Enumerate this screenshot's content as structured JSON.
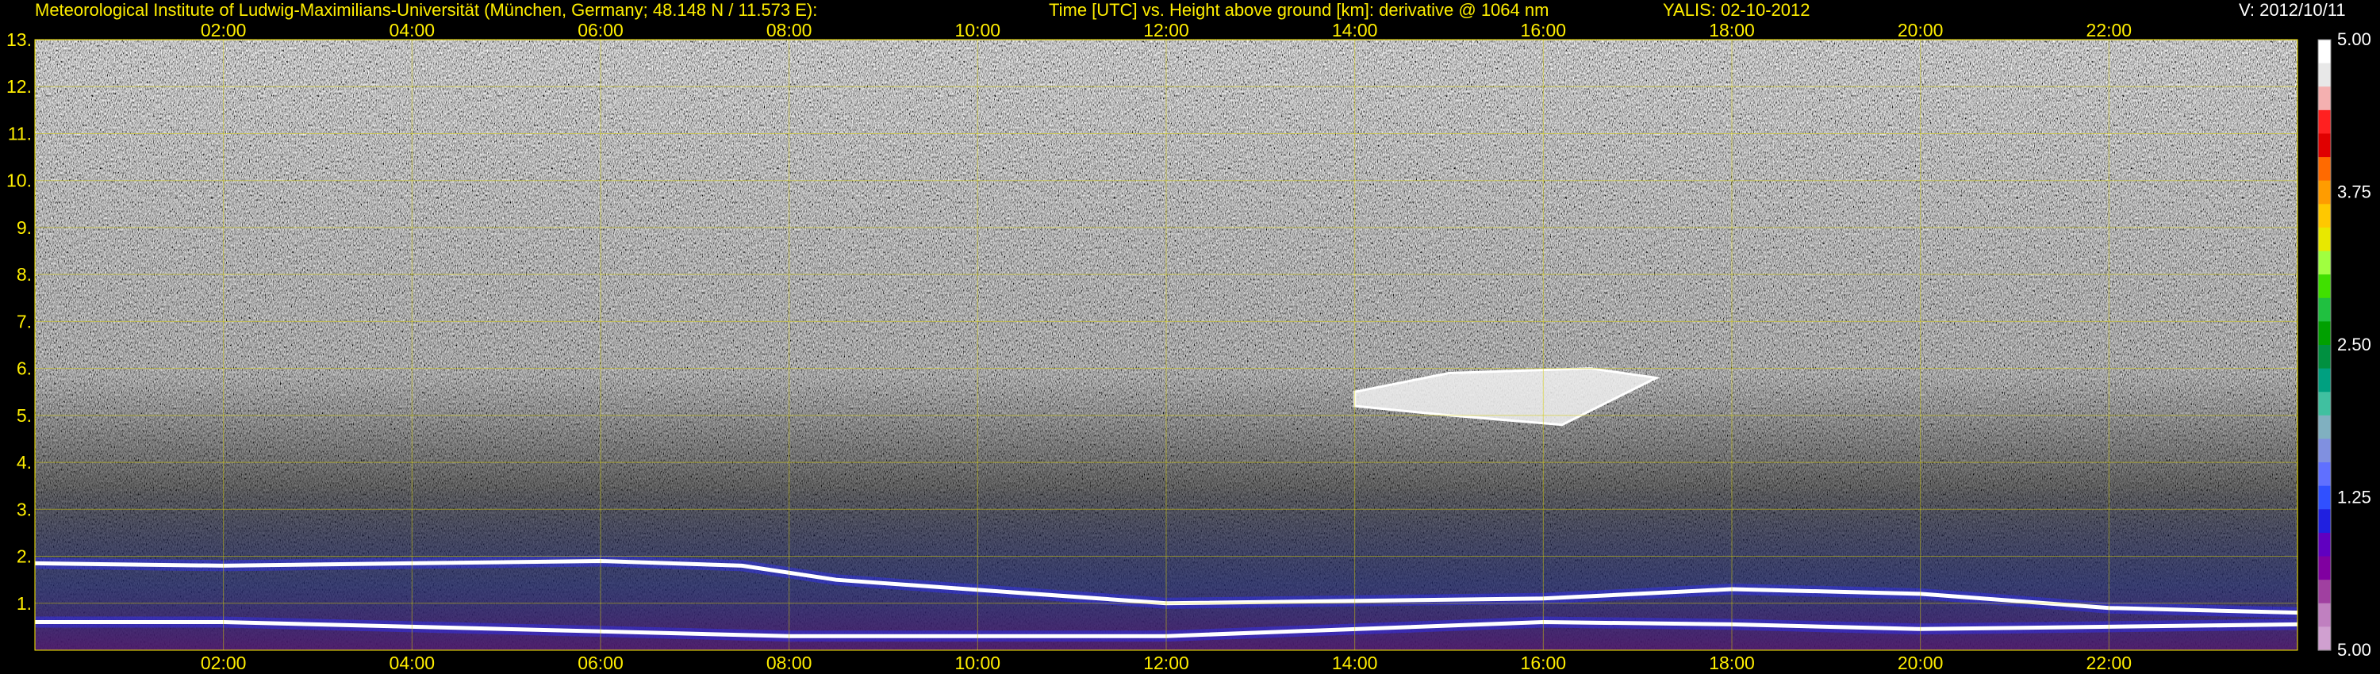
{
  "header": {
    "institution": "Meteorological Institute of Ludwig-Maximilians-Universität (München, Germany; 48.148 N / 11.573 E):",
    "axes_desc": "Time [UTC] vs. Height above ground [km]: derivative @ 1064 nm",
    "device_date": "YALIS: 02-10-2012",
    "version": "V: 2012/10/11"
  },
  "chart_data": {
    "type": "heatmap",
    "title": "Time [UTC] vs. Height above ground [km]: derivative @ 1064 nm",
    "x": {
      "range_hours": [
        0,
        24
      ],
      "ticks": [
        2,
        4,
        6,
        8,
        10,
        12,
        14,
        16,
        18,
        20,
        22
      ],
      "tick_labels": [
        "02:00",
        "04:00",
        "06:00",
        "08:00",
        "10:00",
        "12:00",
        "14:00",
        "16:00",
        "18:00",
        "20:00",
        "22:00"
      ]
    },
    "y": {
      "range_km": [
        0,
        13
      ],
      "ticks": [
        1,
        2,
        3,
        4,
        5,
        6,
        7,
        8,
        9,
        10,
        11,
        12,
        13
      ],
      "tick_labels": [
        "1.",
        "2.",
        "3.",
        "4.",
        "5.",
        "6.",
        "7.",
        "8.",
        "9.",
        "10.",
        "11.",
        "12.",
        "13."
      ]
    },
    "grid": true,
    "colorbar": {
      "tick_labels": [
        "5.00",
        "3.75",
        "2.50",
        "1.25",
        "5.00"
      ],
      "tick_positions": [
        0,
        0.25,
        0.5,
        0.75,
        1.0
      ],
      "colors": [
        "#ffffff",
        "#e8e8e8",
        "#f4b0b0",
        "#ff2020",
        "#e00000",
        "#ff6a00",
        "#ff9c00",
        "#ffc800",
        "#e8e800",
        "#a0ff40",
        "#40e000",
        "#20c040",
        "#00a000",
        "#009040",
        "#00a080",
        "#40c0a0",
        "#80b0c0",
        "#8090e0",
        "#6070ff",
        "#3050ff",
        "#2020e0",
        "#6000c0",
        "#8000a0",
        "#a040a0",
        "#c080c0",
        "#d0a0d0"
      ]
    },
    "features": [
      {
        "name": "aerosol-layer-top",
        "points": [
          [
            0,
            1.85
          ],
          [
            2,
            1.8
          ],
          [
            4,
            1.85
          ],
          [
            6,
            1.9
          ],
          [
            7.5,
            1.8
          ],
          [
            8.5,
            1.5
          ],
          [
            12,
            1.0
          ],
          [
            16,
            1.1
          ],
          [
            18,
            1.3
          ],
          [
            20,
            1.2
          ],
          [
            22,
            0.9
          ],
          [
            24,
            0.8
          ]
        ]
      },
      {
        "name": "surface-layer",
        "points": [
          [
            0,
            0.6
          ],
          [
            2,
            0.6
          ],
          [
            4,
            0.5
          ],
          [
            6,
            0.4
          ],
          [
            8,
            0.3
          ],
          [
            12,
            0.3
          ],
          [
            16,
            0.6
          ],
          [
            18,
            0.55
          ],
          [
            20,
            0.45
          ],
          [
            22,
            0.5
          ],
          [
            24,
            0.55
          ]
        ]
      },
      {
        "name": "cloud-patch",
        "points": [
          [
            14.0,
            5.5
          ],
          [
            15.0,
            5.9
          ],
          [
            16.5,
            6.0
          ],
          [
            17.2,
            5.8
          ],
          [
            16.2,
            4.8
          ],
          [
            15.0,
            5.0
          ],
          [
            14.0,
            5.2
          ]
        ]
      }
    ]
  }
}
